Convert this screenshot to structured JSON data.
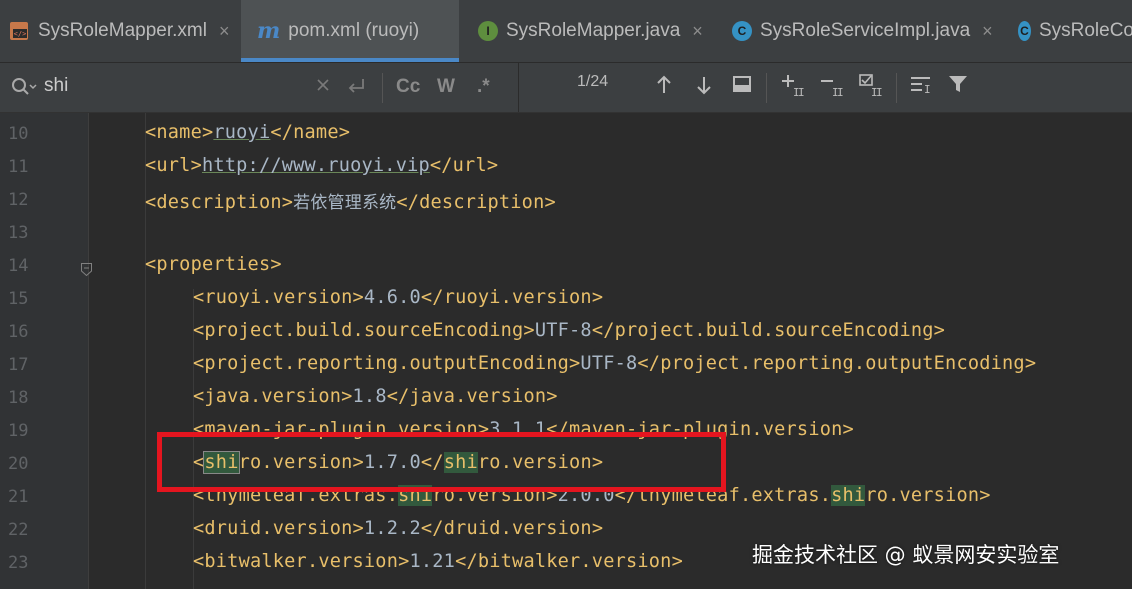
{
  "tabs": [
    {
      "label": "SysRoleMapper.xml",
      "icon": "xml-file-icon",
      "active": false
    },
    {
      "label": "pom.xml (ruoyi)",
      "icon": "maven-m-icon",
      "active": true
    },
    {
      "label": "SysRoleMapper.java",
      "icon": "interface-i-icon",
      "active": false
    },
    {
      "label": "SysRoleServiceImpl.java",
      "icon": "class-c-icon",
      "active": false
    },
    {
      "label": "SysRoleCo",
      "icon": "class-c-icon",
      "active": false
    }
  ],
  "tab_close_glyph": "×",
  "search": {
    "query": "shi",
    "match_case": "Cc",
    "words": "W",
    "regex": ".*",
    "match_count": "1/24"
  },
  "editor": {
    "lines": [
      {
        "n": "10",
        "tag_open": "<name>",
        "value": "ruoyi",
        "tag_close": "</name>"
      },
      {
        "n": "11",
        "tag_open": "<url>",
        "value": "http://www.ruoyi.vip",
        "tag_close": "</url>"
      },
      {
        "n": "12",
        "tag_open": "<description>",
        "value": "若依管理系统",
        "tag_close": "</description>"
      },
      {
        "n": "13"
      },
      {
        "n": "14",
        "tag_open": "<properties>"
      },
      {
        "n": "15",
        "tag_open": "<ruoyi.version>",
        "value": "4.6.0",
        "tag_close": "</ruoyi.version>"
      },
      {
        "n": "16",
        "tag_open": "<project.build.sourceEncoding>",
        "value": "UTF-8",
        "tag_close": "</project.build.sourceEncoding>"
      },
      {
        "n": "17",
        "tag_open": "<project.reporting.outputEncoding>",
        "value": "UTF-8",
        "tag_close": "</project.reporting.outputEncoding>"
      },
      {
        "n": "18",
        "tag_open": "<java.version>",
        "value": "1.8",
        "tag_close": "</java.version>"
      },
      {
        "n": "19",
        "tag_open": "<maven-jar-plugin.version>",
        "value": "3.1.1",
        "tag_close": "</maven-jar-plugin.version>"
      },
      {
        "n": "20",
        "tag_open": "<shiro.version>",
        "value": "1.7.0",
        "tag_close": "</shiro.version>"
      },
      {
        "n": "21",
        "tag_open": "<thymeleaf.extras.shiro.version>",
        "value": "2.0.0",
        "tag_close": "</thymeleaf.extras.shiro.version>"
      },
      {
        "n": "22",
        "tag_open": "<druid.version>",
        "value": "1.2.2",
        "tag_close": "</druid.version>"
      },
      {
        "n": "23",
        "tag_open": "<bitwalker.version>",
        "value": "1.21",
        "tag_close": "</bitwalker.version>"
      }
    ]
  },
  "watermark": "掘金技术社区 @ 蚁景网安实验室",
  "colors": {
    "tag": "#e8bf6a",
    "text": "#a9b7c6",
    "match_highlight": "#32593d",
    "annotation_box": "#e4151f",
    "active_tab_underline": "#4a88c7"
  }
}
